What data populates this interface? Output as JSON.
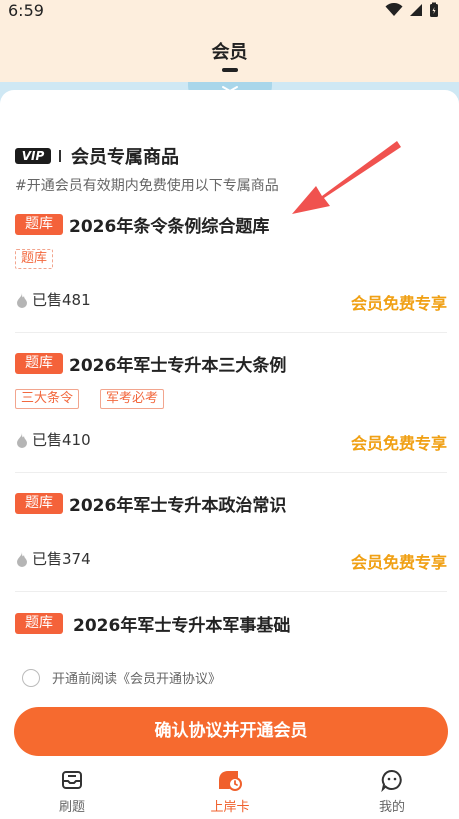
{
  "status_bar": {
    "time": "6:59"
  },
  "header": {
    "title": "会员"
  },
  "section": {
    "vip_label": "VIP",
    "title": "会员专属商品",
    "subtitle": "#开通会员有效期内免费使用以下专属商品"
  },
  "items": [
    {
      "category": "题库",
      "title": "2026年条令条例综合题库",
      "tags": [
        "题库"
      ],
      "sold": "已售481",
      "price_label": "会员免费专享"
    },
    {
      "category": "题库",
      "title": "2026年军士专升本三大条例",
      "tags": [
        "三大条令",
        "军考必考"
      ],
      "sold": "已售410",
      "price_label": "会员免费专享"
    },
    {
      "category": "题库",
      "title": "2026年军士专升本政治常识",
      "tags": [],
      "sold": "已售374",
      "price_label": "会员免费专享"
    },
    {
      "category": "题库",
      "title": "2026年军士专升本军事基础",
      "tags": [],
      "sold": "",
      "price_label": ""
    }
  ],
  "agreement": {
    "text": "开通前阅读《会员开通协议》"
  },
  "cta": {
    "label": "确认协议并开通会员"
  },
  "tabbar": {
    "tabs": [
      {
        "label": "刷题",
        "icon": "inbox-icon",
        "active": false
      },
      {
        "label": "上岸卡",
        "icon": "card-clock-icon",
        "active": true
      },
      {
        "label": "我的",
        "icon": "chat-bubble-icon",
        "active": false
      }
    ]
  },
  "colors": {
    "accent": "#f66a2f",
    "badge": "#f4623a",
    "price": "#f0a014",
    "header_bg": "#fdeedd",
    "arrow": "#f0524f"
  }
}
